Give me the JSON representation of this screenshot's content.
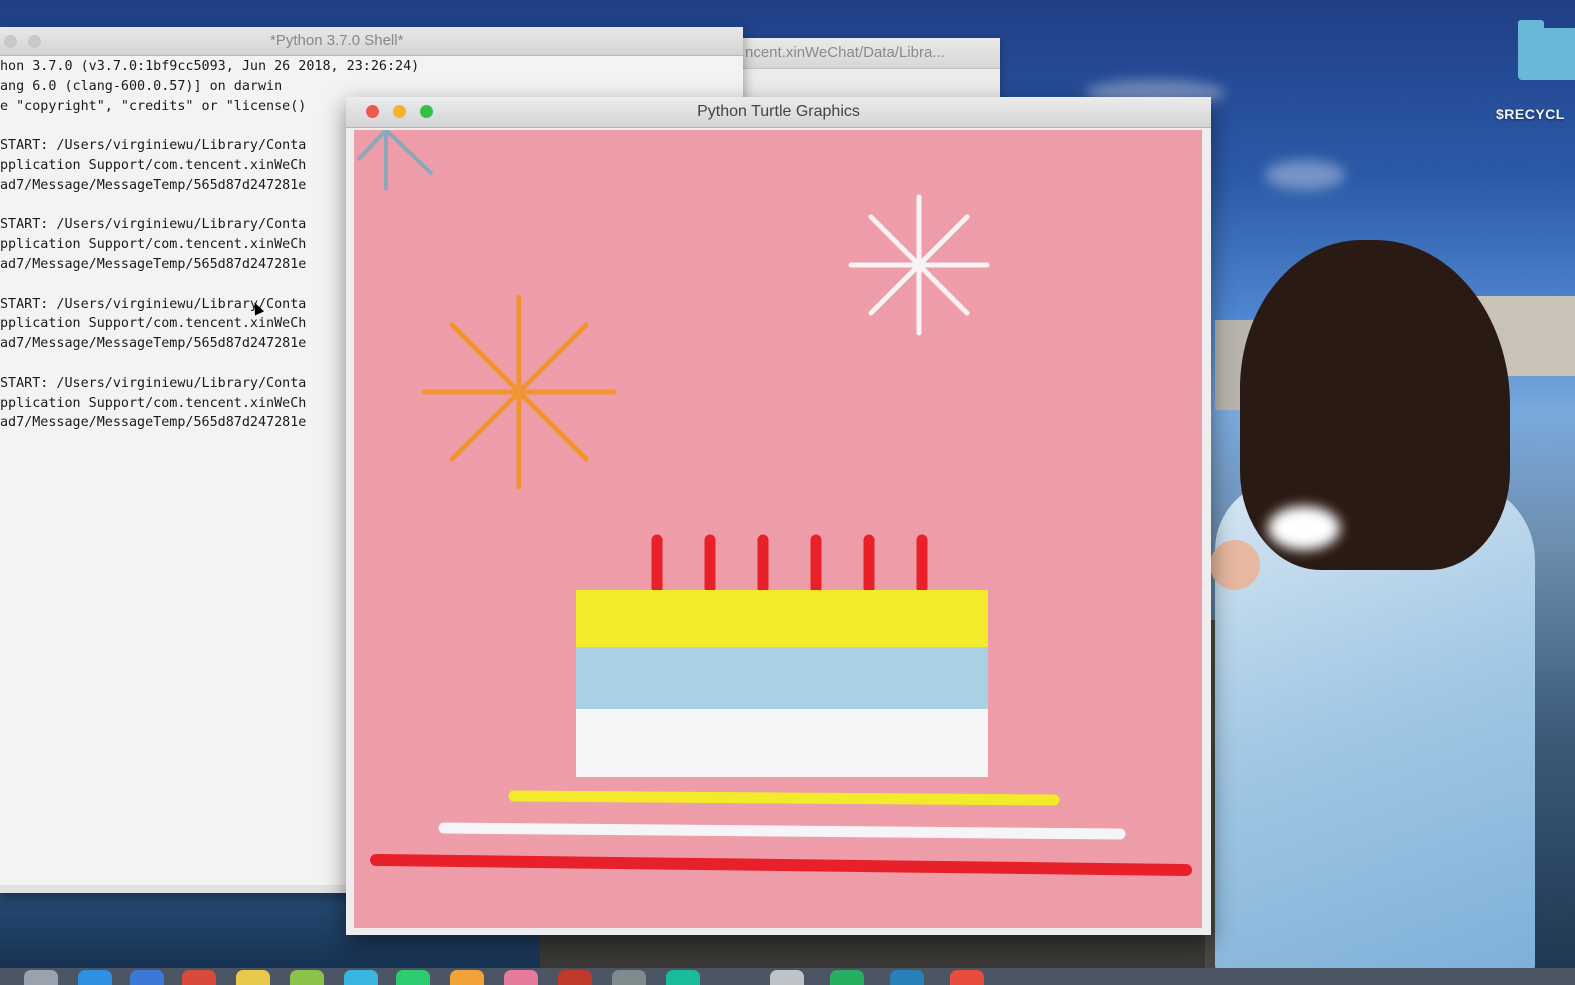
{
  "desktop": {
    "icon_label": "$RECYCL",
    "folder_icon": "folder-icon"
  },
  "shell_window": {
    "title": "*Python 3.7.0 Shell*",
    "lines": [
      "hon 3.7.0 (v3.7.0:1bf9cc5093, Jun 26 2018, 23:26:24)",
      "ang 6.0 (clang-600.0.57)] on darwin",
      "e \"copyright\", \"credits\" or \"license()",
      "",
      "START: /Users/virginiewu/Library/Conta",
      "pplication Support/com.tencent.xinWeCh",
      "ad7/Message/MessageTemp/565d87d247281e",
      "",
      "START: /Users/virginiewu/Library/Conta",
      "pplication Support/com.tencent.xinWeCh",
      "ad7/Message/MessageTemp/565d87d247281e",
      "",
      "START: /Users/virginiewu/Library/Conta",
      "pplication Support/com.tencent.xinWeCh",
      "ad7/Message/MessageTemp/565d87d247281e",
      "",
      "START: /Users/virginiewu/Library/Conta",
      "pplication Support/com.tencent.xinWeCh",
      "ad7/Message/MessageTemp/565d87d247281e"
    ]
  },
  "wechat_window": {
    "title": "ncent.xinWeChat/Data/Libra..."
  },
  "turtle_window": {
    "title": "Python Turtle Graphics",
    "canvas_bg": "#ee9ca7",
    "cake": {
      "candle_color": "#e8202a",
      "candle_count": 6,
      "layers": [
        "#f2ea2a",
        "#a8d2e4",
        "#f5f4f6"
      ],
      "plate_lines": [
        "#f2ea2a",
        "#f5f4f6",
        "#e8202a"
      ]
    },
    "fireworks": [
      {
        "color": "#f29430",
        "name": "orange-firework"
      },
      {
        "color": "#f7f2f3",
        "name": "white-firework"
      }
    ],
    "turtle_color": "#8aa9b8"
  },
  "traffic_lights": {
    "close": "#ee5a50",
    "minimize": "#f2b232",
    "zoom": "#37c046"
  }
}
